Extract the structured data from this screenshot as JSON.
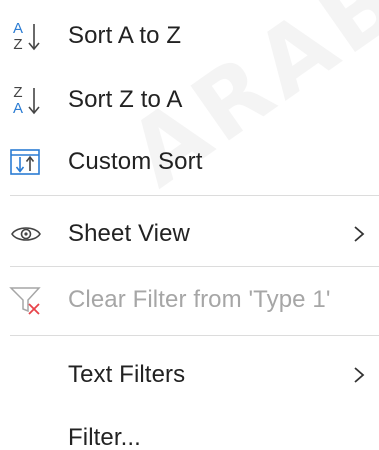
{
  "menu": {
    "items": [
      {
        "label": "Sort A to Z",
        "icon": "sort-a-to-z-icon"
      },
      {
        "label": "Sort Z to A",
        "icon": "sort-z-to-a-icon"
      },
      {
        "label": "Custom Sort",
        "icon": "custom-sort-icon"
      },
      {
        "label": "Sheet View",
        "icon": "eye-icon",
        "submenu": true
      },
      {
        "label": "Clear Filter from 'Type 1'",
        "icon": "clear-filter-icon",
        "disabled": true
      },
      {
        "label": "Text Filters",
        "submenu": true
      },
      {
        "label": "Filter..."
      }
    ]
  },
  "icons": {
    "sort_a_to_z": {
      "top": "A",
      "bottom": "Z"
    },
    "sort_z_to_a": {
      "top": "Z",
      "bottom": "A"
    }
  },
  "watermark": "ARAB",
  "colors": {
    "accent_blue": "#2b7cd3",
    "icon_gray": "#444444",
    "disabled_gray": "#a6a6a6",
    "clear_filter_red": "#e8434a",
    "separator": "#dcdcdc"
  }
}
